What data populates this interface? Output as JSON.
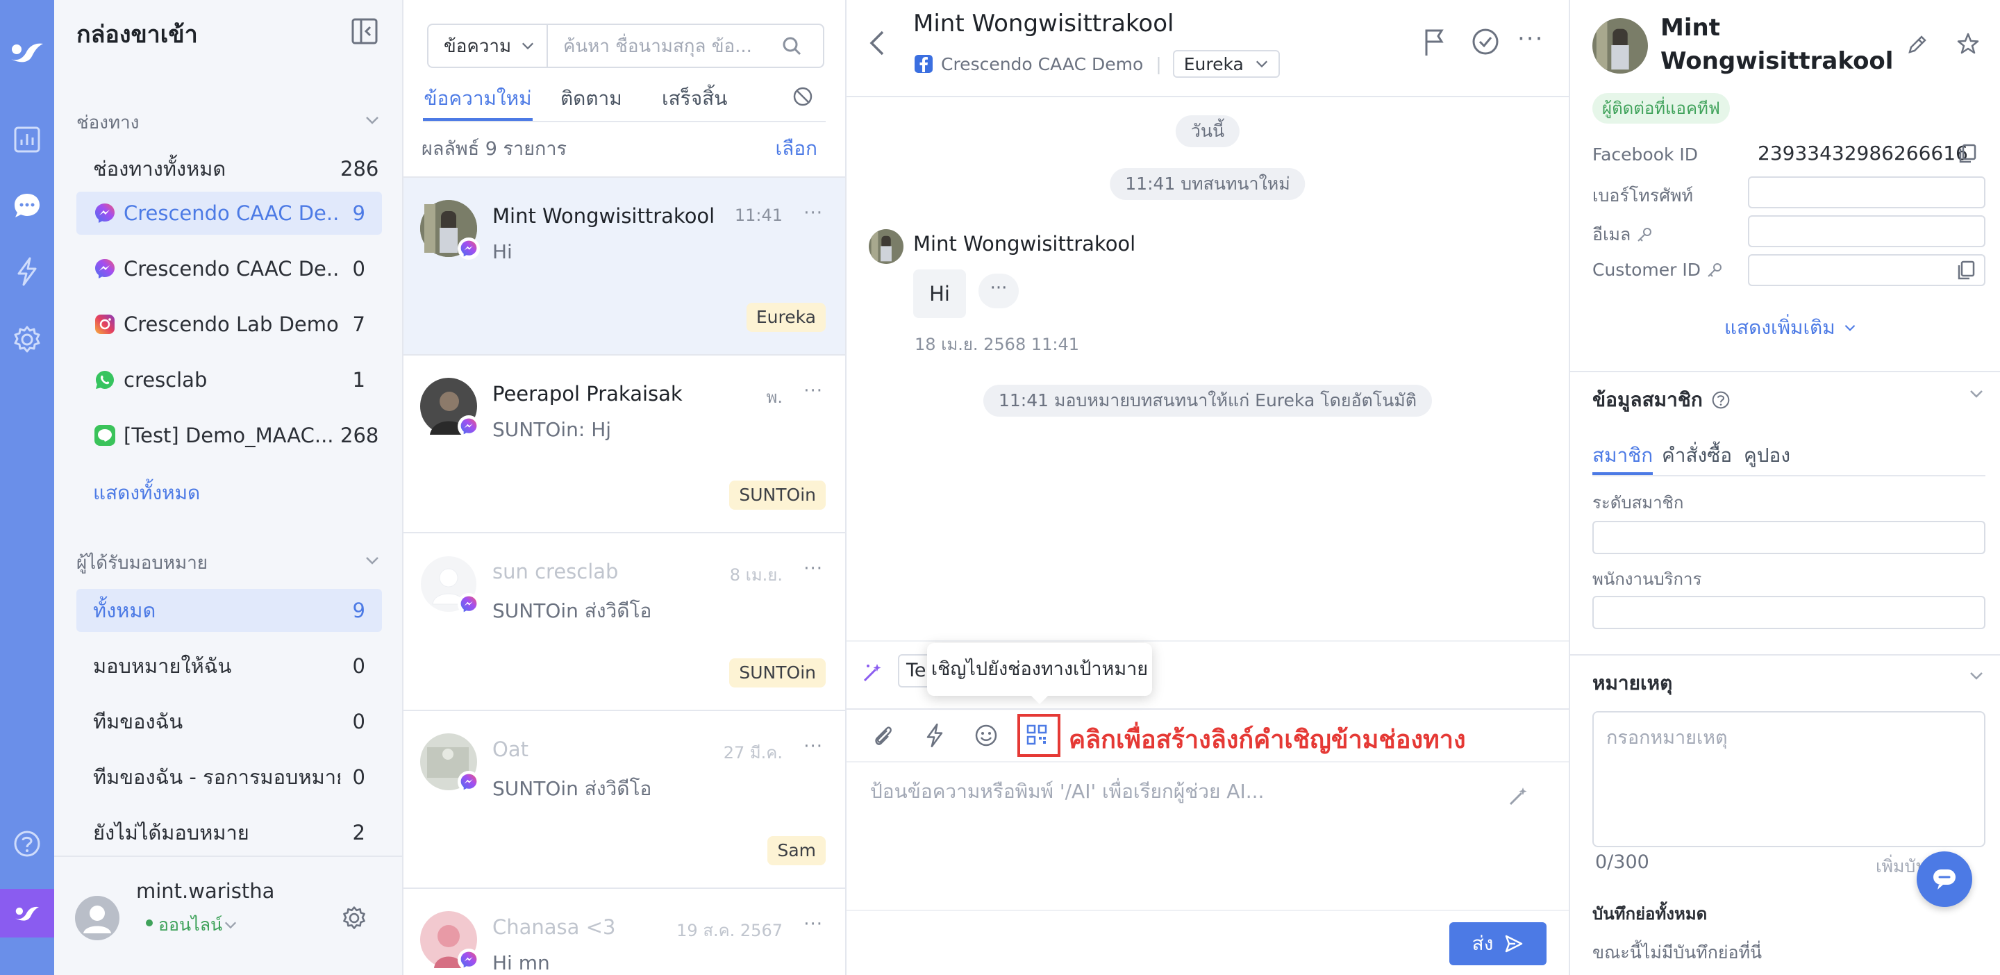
{
  "colors": {
    "rail": "#6a8fe9",
    "accent": "#4c7ae5",
    "annotation": "#e53935"
  },
  "inbox": {
    "title": "กล่องขาเข้า",
    "channels_heading": "ช่องทาง",
    "channels": [
      {
        "label": "ช่องทางทั้งหมด",
        "count": "286",
        "icon": "none"
      },
      {
        "label": "Crescendo CAAC De...",
        "count": "9",
        "icon": "messenger-icon"
      },
      {
        "label": "Crescendo CAAC De...",
        "count": "0",
        "icon": "messenger-icon"
      },
      {
        "label": "Crescendo Lab Demo",
        "count": "7",
        "icon": "instagram-icon"
      },
      {
        "label": "cresclab",
        "count": "1",
        "icon": "whatsapp-icon"
      },
      {
        "label": "[Test] Demo_MAAC...",
        "count": "268",
        "icon": "line-icon"
      }
    ],
    "show_all": "แสดงทั้งหมด",
    "assignee_heading": "ผู้ได้รับมอบหมาย",
    "assignees": [
      {
        "label": "ทั้งหมด",
        "count": "9"
      },
      {
        "label": "มอบหมายให้ฉัน",
        "count": "0"
      },
      {
        "label": "ทีมของฉัน",
        "count": "0"
      },
      {
        "label": "ทีมของฉัน - รอการมอบหมาย",
        "count": "0"
      },
      {
        "label": "ยังไม่ได้มอบหมาย",
        "count": "2"
      }
    ],
    "user": {
      "name": "mint.waristha",
      "status": "ออนไลน์"
    }
  },
  "convlist": {
    "filter": "ข้อความ",
    "search_placeholder": "ค้นหา ชื่อนามสกุล ข้อ...",
    "tabs": [
      "ข้อความใหม่",
      "ติดตาม",
      "เสร็จสิ้น"
    ],
    "result": "ผลลัพธ์ 9 รายการ",
    "select": "เลือก",
    "conversations": [
      {
        "name": "Mint Wongwisittrakool",
        "time": "11:41",
        "msg": "Hi",
        "tag": "Eureka"
      },
      {
        "name": "Peerapol Prakaisak",
        "time": "พ.",
        "msg": "SUNTOin: Hj",
        "tag": "SUNTOin"
      },
      {
        "name": "sun cresclab",
        "time": "8 เม.ย.",
        "msg": "SUNTOin ส่งวิดีโอ",
        "tag": "SUNTOin"
      },
      {
        "name": "Oat",
        "time": "27 มี.ค.",
        "msg": "SUNTOin ส่งวิดีโอ",
        "tag": "Sam"
      },
      {
        "name": "Chanasa <3",
        "time": "19 ส.ค. 2567",
        "msg": "Hi mn",
        "tag": ""
      }
    ]
  },
  "chat": {
    "name": "Mint Wongwisittrakool",
    "channel": "Crescendo CAAC Demo",
    "assignee": "Eureka",
    "today": "วันนี้",
    "new_chat": "11:41 บทสนทนาใหม่",
    "sender": "Mint Wongwisittrakool",
    "message": "Hi",
    "more": "···",
    "message_time": "18 เม.ย. 2568 11:41",
    "assign_note": "11:41 มอบหมายบทสนทนาให้แก่  Eureka โดยอัตโนมัติ",
    "tooltip": "เชิญไปยังช่องทางเป้าหมาย",
    "annotation": "คลิกเพื่อสร้างลิงก์คำเชิญข้ามช่องทาง",
    "template_prefix": "Te",
    "composer_placeholder": "ป้อนข้อความหรือพิมพ์ '/AI' เพื่อเรียกผู้ช่วย AI...",
    "send": "ส่ง"
  },
  "profile": {
    "name": "Mint Wongwisittrakool",
    "status_tag": "ผู้ติดต่อที่แอคทีฟ",
    "fields": [
      {
        "label": "Facebook ID",
        "value": "23933432986266616"
      },
      {
        "label": "เบอร์โทรศัพท์",
        "value": ""
      },
      {
        "label": "อีเมล",
        "value": ""
      },
      {
        "label": "Customer ID",
        "value": ""
      }
    ],
    "show_more": "แสดงเพิ่มเติม",
    "member_heading": "ข้อมูลสมาชิก",
    "member_tabs": [
      "สมาชิก",
      "คำสั่งซื้อ",
      "คูปอง"
    ],
    "member_level": "ระดับสมาชิก",
    "service_staff": "พนักงานบริการ",
    "notes_heading": "หมายเหตุ",
    "notes_placeholder": "กรอกหมายเหตุ",
    "notes_count": "0/300",
    "notes_add": "เพิ่มบันทึกย่อ",
    "all_notes": "บันทึกย่อทั้งหมด",
    "no_notes": "ขณะนี้ไม่มีบันทึกย่อที่นี่"
  }
}
